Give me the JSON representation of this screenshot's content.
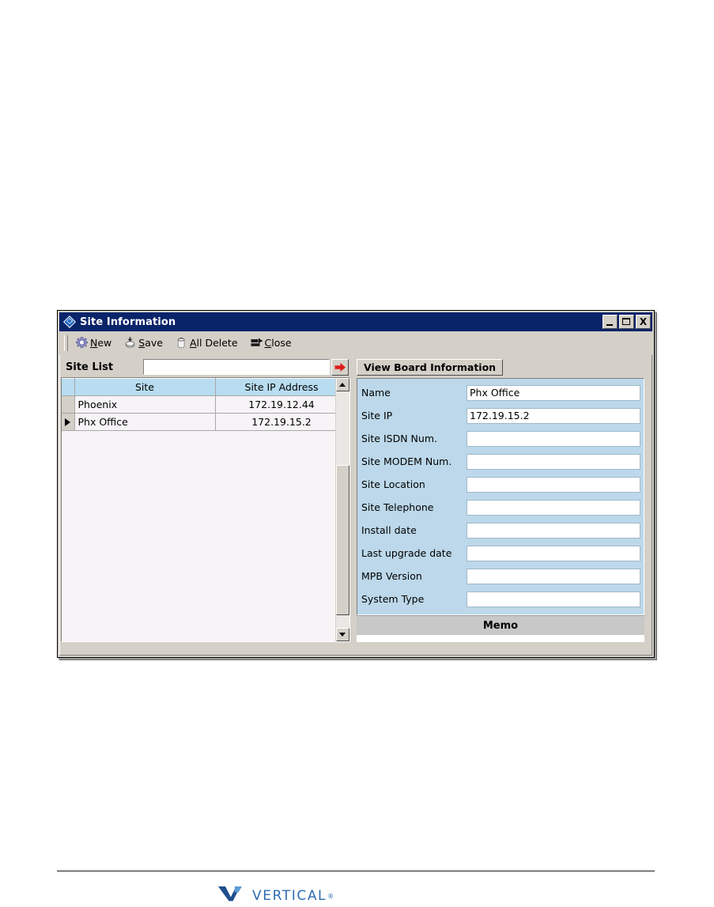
{
  "window": {
    "title": "Site Information",
    "title_icon": "diamond-app-icon",
    "controls": {
      "minimize": "minimize-icon",
      "maximize": "maximize-icon",
      "close": "X"
    }
  },
  "toolbar": {
    "items": [
      {
        "label": "New",
        "accel": "N",
        "icon": "gear-icon"
      },
      {
        "label": "Save",
        "accel": "S",
        "icon": "save-disk-icon"
      },
      {
        "label": "All Delete",
        "accel": "A",
        "icon": "trash-can-icon"
      },
      {
        "label": "Close",
        "accel": "C",
        "icon": "exit-door-arrow-icon"
      }
    ]
  },
  "site_list": {
    "label": "Site List",
    "input_value": "",
    "input_placeholder": "",
    "go_button_icon": "red-right-arrow-icon"
  },
  "grid": {
    "columns": [
      "",
      "Site",
      "Site IP Address"
    ],
    "rows": [
      {
        "marker": "",
        "site": "Phoenix",
        "ip": "172.19.12.44"
      },
      {
        "marker": "▶",
        "site": "Phx Office",
        "ip": "172.19.15.2"
      }
    ],
    "selected_row_index": 1
  },
  "scrollbar": {
    "up_arrow": "scroll-up-icon",
    "down_arrow": "scroll-down-icon"
  },
  "right_panel": {
    "view_board_button": "View Board Information",
    "fields": [
      {
        "label": "Name",
        "value": "Phx Office"
      },
      {
        "label": "Site IP",
        "value": "172.19.15.2"
      },
      {
        "label": "Site ISDN Num.",
        "value": ""
      },
      {
        "label": "Site MODEM Num.",
        "value": ""
      },
      {
        "label": "Site Location",
        "value": ""
      },
      {
        "label": "Site Telephone",
        "value": ""
      },
      {
        "label": "Install date",
        "value": ""
      },
      {
        "label": "Last upgrade date",
        "value": ""
      },
      {
        "label": "MPB Version",
        "value": ""
      },
      {
        "label": "System Type",
        "value": ""
      }
    ],
    "memo_header": "Memo",
    "memo_value": ""
  },
  "footer": {
    "logo_text": "VERTICAL",
    "logo_tm": "®"
  },
  "colors": {
    "titlebar": "#0a246a",
    "window_face": "#d4d0c8",
    "grid_header": "#b8dcf0",
    "form_bg": "#bcd8ea",
    "memo_bg": "#c8c8c8",
    "accent_red": "#e01b1b",
    "logo_blue": "#2f6cb0",
    "logo_navy": "#1f4e8c"
  }
}
